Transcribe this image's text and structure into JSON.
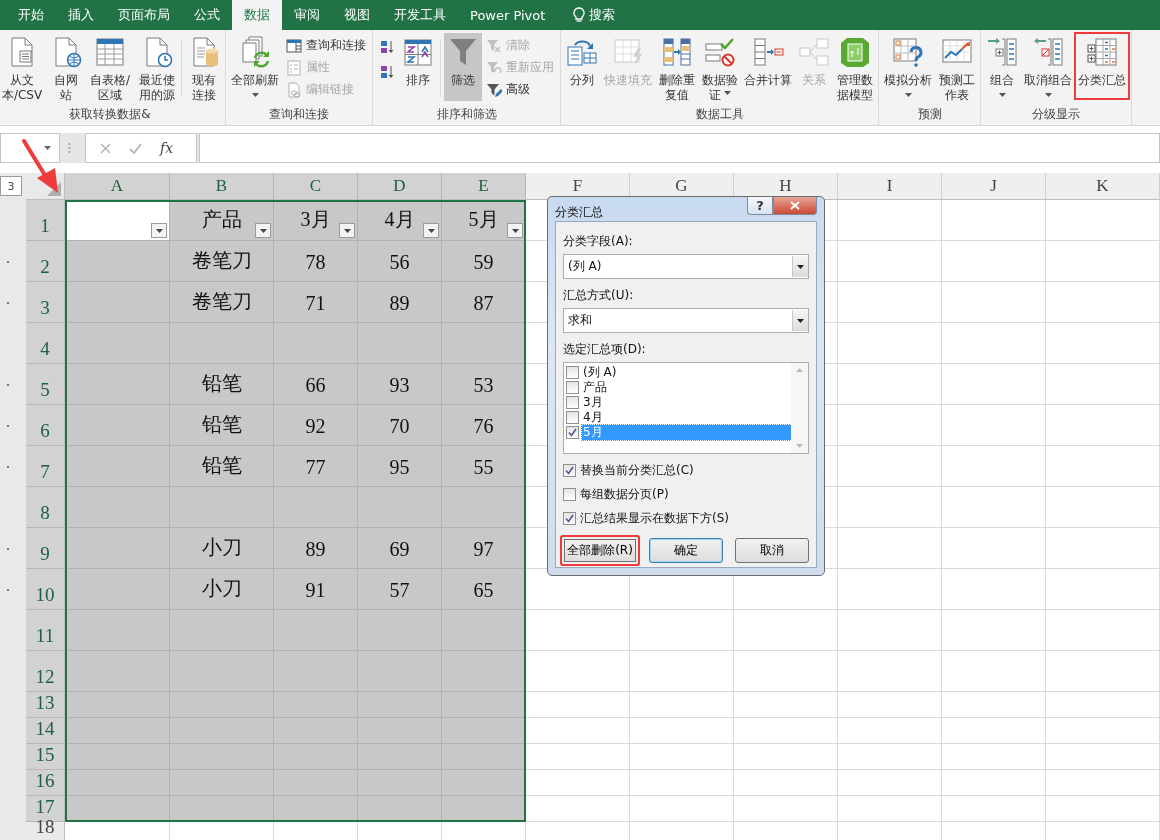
{
  "tabs": [
    {
      "kind": "tab",
      "label": "开始",
      "selected": false
    },
    {
      "kind": "tab",
      "label": "插入",
      "selected": false
    },
    {
      "kind": "tab",
      "label": "页面布局",
      "selected": false
    },
    {
      "kind": "tab",
      "label": "公式",
      "selected": false
    },
    {
      "kind": "tab",
      "label": "数据",
      "selected": true
    },
    {
      "kind": "tab",
      "label": "审阅",
      "selected": false
    },
    {
      "kind": "tab",
      "label": "视图",
      "selected": false
    },
    {
      "kind": "tab",
      "label": "开发工具",
      "selected": false
    },
    {
      "kind": "tab",
      "label": "Power Pivot",
      "selected": false
    },
    {
      "kind": "search",
      "label": "搜索",
      "selected": false
    }
  ],
  "ribbon": {
    "groups": [
      {
        "label": "获取转换数据&",
        "items": [
          {
            "kind": "large",
            "label": "从文本/CSV",
            "dropdown": false,
            "disabled": false,
            "pressed": false,
            "highlighted": false
          },
          {
            "kind": "large",
            "label": "自网站",
            "dropdown": false,
            "disabled": false,
            "pressed": false,
            "highlighted": false
          },
          {
            "kind": "large",
            "label": "自表格/区域",
            "dropdown": false,
            "disabled": false,
            "pressed": false,
            "highlighted": false
          },
          {
            "kind": "large",
            "label": "最近使用的源",
            "dropdown": false,
            "disabled": false,
            "pressed": false,
            "highlighted": false
          },
          {
            "kind": "separator"
          },
          {
            "kind": "large",
            "label": "现有连接",
            "dropdown": false,
            "disabled": false,
            "pressed": false,
            "highlighted": false
          }
        ]
      },
      {
        "label": "查询和连接",
        "items": [
          {
            "kind": "large",
            "label": "全部刷新",
            "dropdown": true,
            "disabled": false,
            "pressed": false,
            "highlighted": false
          },
          {
            "kind": "stack",
            "items": [
              {
                "kind": "small",
                "label": "查询和连接",
                "disabled": false
              },
              {
                "kind": "small",
                "label": "属性",
                "disabled": true
              },
              {
                "kind": "small",
                "label": "编辑链接",
                "disabled": true
              }
            ]
          }
        ]
      },
      {
        "label": "排序和筛选",
        "items": [
          {
            "kind": "stack",
            "items": [
              {
                "kind": "icon",
                "disabled": false
              },
              {
                "kind": "icon",
                "disabled": false
              }
            ]
          },
          {
            "kind": "large",
            "label": "排序",
            "dropdown": false,
            "disabled": false,
            "pressed": false,
            "highlighted": false
          },
          {
            "kind": "separator"
          },
          {
            "kind": "large",
            "label": "筛选",
            "dropdown": false,
            "disabled": false,
            "pressed": true,
            "highlighted": false
          },
          {
            "kind": "stack",
            "items": [
              {
                "kind": "small",
                "label": "清除",
                "disabled": true
              },
              {
                "kind": "small",
                "label": "重新应用",
                "disabled": true
              },
              {
                "kind": "small",
                "label": "高级",
                "disabled": false
              }
            ]
          }
        ]
      },
      {
        "label": "数据工具",
        "items": [
          {
            "kind": "large",
            "label": "分列",
            "dropdown": false,
            "disabled": false,
            "pressed": false,
            "highlighted": false
          },
          {
            "kind": "large",
            "label": "快速填充",
            "dropdown": false,
            "disabled": true,
            "pressed": false,
            "highlighted": false
          },
          {
            "kind": "large",
            "label": "删除重复值",
            "dropdown": false,
            "disabled": false,
            "pressed": false,
            "highlighted": false
          },
          {
            "kind": "large",
            "label": "数据验证",
            "dropdown": true,
            "disabled": false,
            "pressed": false,
            "highlighted": false
          },
          {
            "kind": "large",
            "label": "合并计算",
            "dropdown": false,
            "disabled": false,
            "pressed": false,
            "highlighted": false
          },
          {
            "kind": "large",
            "label": "关系",
            "dropdown": false,
            "disabled": true,
            "pressed": false,
            "highlighted": false
          },
          {
            "kind": "large",
            "label": "管理数据模型",
            "dropdown": false,
            "disabled": false,
            "pressed": false,
            "highlighted": false
          }
        ]
      },
      {
        "label": "预测",
        "items": [
          {
            "kind": "large",
            "label": "模拟分析",
            "dropdown": true,
            "disabled": false,
            "pressed": false,
            "highlighted": false
          },
          {
            "kind": "large",
            "label": "预测工作表",
            "dropdown": false,
            "disabled": false,
            "pressed": false,
            "highlighted": false
          }
        ]
      },
      {
        "label": "分级显示",
        "items": [
          {
            "kind": "large",
            "label": "组合",
            "dropdown": true,
            "disabled": false,
            "pressed": false,
            "highlighted": false
          },
          {
            "kind": "large",
            "label": "取消组合",
            "dropdown": true,
            "disabled": false,
            "pressed": false,
            "highlighted": false
          },
          {
            "kind": "large",
            "label": "分类汇总",
            "dropdown": false,
            "disabled": false,
            "pressed": false,
            "highlighted": true
          }
        ]
      }
    ]
  },
  "formula_bar": {
    "function_button": "fx"
  },
  "sheet": {
    "outline_level_button": "3",
    "columns": [
      {
        "label": "A",
        "selected": true
      },
      {
        "label": "B",
        "selected": true
      },
      {
        "label": "C",
        "selected": true
      },
      {
        "label": "D",
        "selected": true
      },
      {
        "label": "E",
        "selected": true
      },
      {
        "label": "F",
        "selected": false
      },
      {
        "label": "G",
        "selected": false
      },
      {
        "label": "H",
        "selected": false
      },
      {
        "label": "I",
        "selected": false
      },
      {
        "label": "J",
        "selected": false
      },
      {
        "label": "K",
        "selected": false
      }
    ],
    "rows": [
      {
        "label": "1",
        "selected": true,
        "outline_detail": false,
        "filter": true,
        "cells": [
          null,
          "产品",
          "3月",
          "4月",
          "5月"
        ]
      },
      {
        "label": "2",
        "selected": true,
        "outline_detail": true,
        "filter": false,
        "cells": [
          null,
          "卷笔刀",
          "78",
          "56",
          "59"
        ]
      },
      {
        "label": "3",
        "selected": true,
        "outline_detail": true,
        "filter": false,
        "cells": [
          null,
          "卷笔刀",
          "71",
          "89",
          "87"
        ]
      },
      {
        "label": "4",
        "selected": true,
        "outline_detail": false,
        "filter": false
      },
      {
        "label": "5",
        "selected": true,
        "outline_detail": true,
        "filter": false,
        "cells": [
          null,
          "铅笔",
          "66",
          "93",
          "53"
        ]
      },
      {
        "label": "6",
        "selected": true,
        "outline_detail": true,
        "filter": false,
        "cells": [
          null,
          "铅笔",
          "92",
          "70",
          "76"
        ]
      },
      {
        "label": "7",
        "selected": true,
        "outline_detail": true,
        "filter": false,
        "cells": [
          null,
          "铅笔",
          "77",
          "95",
          "55"
        ]
      },
      {
        "label": "8",
        "selected": true,
        "outline_detail": false,
        "filter": false
      },
      {
        "label": "9",
        "selected": true,
        "outline_detail": true,
        "filter": false,
        "cells": [
          null,
          "小刀",
          "89",
          "69",
          "97"
        ]
      },
      {
        "label": "10",
        "selected": true,
        "outline_detail": true,
        "filter": false,
        "cells": [
          null,
          "小刀",
          "91",
          "57",
          "65"
        ]
      },
      {
        "label": "11",
        "selected": true,
        "outline_detail": false,
        "filter": false
      },
      {
        "label": "12",
        "selected": true,
        "outline_detail": false,
        "filter": false
      },
      {
        "label": "13",
        "selected": true,
        "outline_detail": false,
        "filter": false
      },
      {
        "label": "14",
        "selected": true,
        "outline_detail": false,
        "filter": false
      },
      {
        "label": "15",
        "selected": true,
        "outline_detail": false,
        "filter": false
      },
      {
        "label": "16",
        "selected": true,
        "outline_detail": false,
        "filter": false
      },
      {
        "label": "17",
        "selected": true,
        "outline_detail": false,
        "filter": false
      },
      {
        "label": "18",
        "selected": false,
        "outline_detail": false,
        "filter": false
      }
    ]
  },
  "dialog": {
    "title": "分类汇总",
    "help_button": "?",
    "group_by": {
      "label": "分类字段(A):",
      "value": "(列 A)"
    },
    "function": {
      "label": "汇总方式(U):",
      "value": "求和"
    },
    "add_subtotal_to": {
      "label": "选定汇总项(D):",
      "items": [
        {
          "label": "(列 A)",
          "checked": false,
          "selected": false
        },
        {
          "label": "产品",
          "checked": false,
          "selected": false
        },
        {
          "label": "3月",
          "checked": false,
          "selected": false
        },
        {
          "label": "4月",
          "checked": false,
          "selected": false
        },
        {
          "label": "5月",
          "checked": true,
          "selected": true
        }
      ]
    },
    "options": [
      {
        "label": "替换当前分类汇总(C)",
        "checked": true
      },
      {
        "label": "每组数据分页(P)",
        "checked": false
      },
      {
        "label": "汇总结果显示在数据下方(S)",
        "checked": true
      }
    ],
    "buttons": [
      {
        "label": "全部删除(R)",
        "default": false,
        "highlighted": true
      },
      {
        "label": "确定",
        "default": true,
        "highlighted": false
      },
      {
        "label": "取消",
        "default": false,
        "highlighted": false
      }
    ]
  }
}
